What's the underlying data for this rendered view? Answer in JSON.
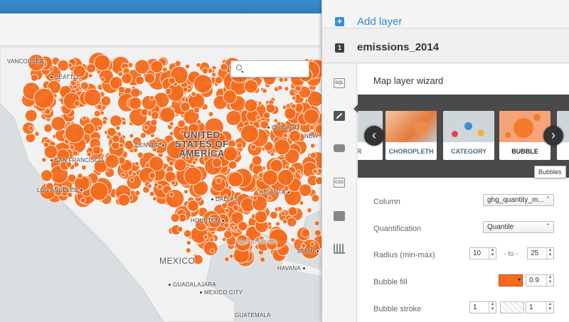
{
  "map": {
    "search": {
      "placeholder": ""
    },
    "labels": {
      "vancouver": "VANCOUVER",
      "seattle": "SEATTLE",
      "san_francisco": "SAN FRANCISCO",
      "los_angeles": "LOS ANGELES",
      "denver": "DENVER",
      "dallas": "DALLAS",
      "houston": "HOUSTON",
      "atlanta": "ATLANTA",
      "chicago": "CHICAGO",
      "new_york": "NEW YO",
      "miami": "MIAMI",
      "havana": "HAVANA",
      "guadalajara": "GUADALAJARA",
      "mexico_city": "MEXICO CITY",
      "guatemala": "GUATEMALA",
      "usa_line1": "UNITED",
      "usa_line2": "STATES OF",
      "usa_line3": "AMERICA",
      "mexico": "MEXICO",
      "gulf": "Gulf of Mexico"
    },
    "bubble_color": "#f26b1d"
  },
  "panel": {
    "add_layer": "Add layer",
    "layer_number": "1",
    "layer_name": "emissions_2014",
    "side_icons": [
      "sql-icon",
      "wizard-icon",
      "infowindow-icon",
      "css-icon",
      "legend-icon",
      "filters-icon"
    ],
    "sql_text": "SQL",
    "css_text": "CSS",
    "wizard": {
      "title": "Map layer wizard",
      "cards": [
        {
          "label": "ER"
        },
        {
          "label": "CHOROPLETH"
        },
        {
          "label": "CATEGORY"
        },
        {
          "label": "BUBBLE",
          "selected": true
        },
        {
          "label": ""
        }
      ],
      "tooltip": "Bubbles",
      "fields": {
        "column_label": "Column",
        "column_value": "ghg_quantity_m...",
        "quantification_label": "Quantification",
        "quantification_value": "Quantile",
        "radius_label": "Radius (min-max)",
        "radius_min": "10",
        "radius_to": "- to -",
        "radius_max": "25",
        "fill_label": "Bubble fill",
        "fill_color": "#f56b1d",
        "fill_opacity": "0.9",
        "stroke_label": "Bubble stroke",
        "stroke_width": "1",
        "stroke_opacity": "1"
      }
    }
  }
}
